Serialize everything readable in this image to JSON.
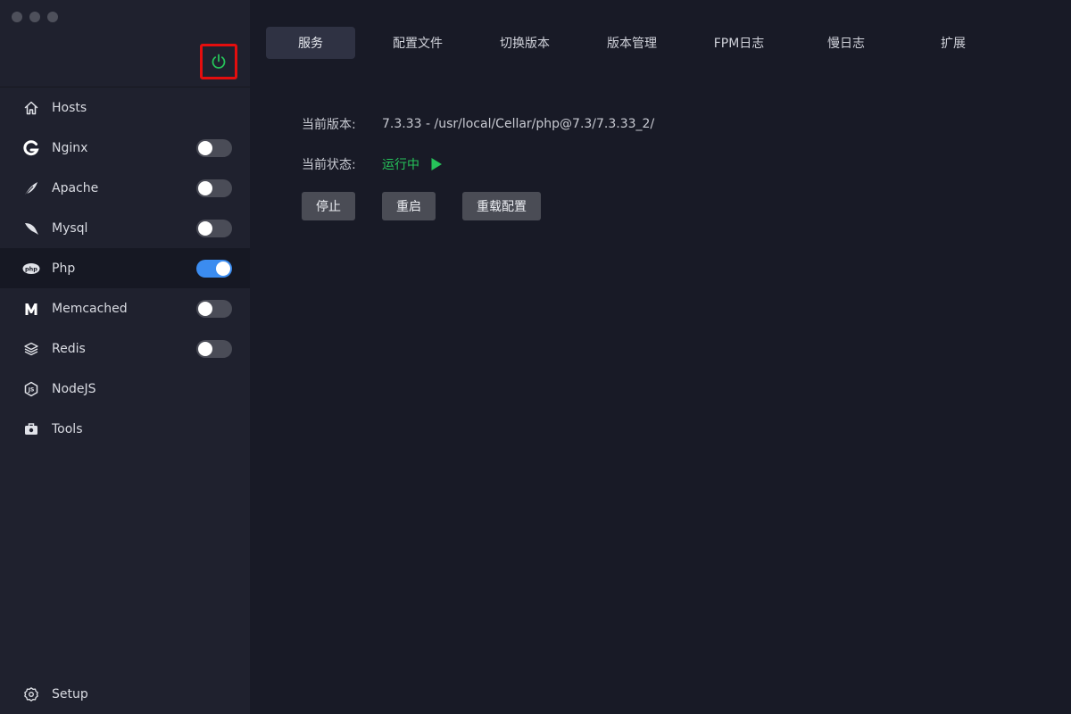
{
  "sidebar": {
    "items": [
      {
        "label": "Hosts",
        "icon": "home-icon"
      },
      {
        "label": "Nginx",
        "icon": "nginx-icon",
        "toggle": false
      },
      {
        "label": "Apache",
        "icon": "apache-feather-icon",
        "toggle": false
      },
      {
        "label": "Mysql",
        "icon": "mysql-dolphin-icon",
        "toggle": false
      },
      {
        "label": "Php",
        "icon": "php-icon",
        "toggle": true,
        "active": true
      },
      {
        "label": "Memcached",
        "icon": "memcached-icon",
        "toggle": false
      },
      {
        "label": "Redis",
        "icon": "redis-icon",
        "toggle": false
      },
      {
        "label": "NodeJS",
        "icon": "nodejs-icon"
      },
      {
        "label": "Tools",
        "icon": "toolbox-icon"
      }
    ],
    "setup": {
      "label": "Setup",
      "icon": "gear-icon"
    }
  },
  "tabs": [
    {
      "label": "服务",
      "active": true
    },
    {
      "label": "配置文件"
    },
    {
      "label": "切换版本"
    },
    {
      "label": "版本管理"
    },
    {
      "label": "FPM日志"
    },
    {
      "label": "慢日志"
    },
    {
      "label": "扩展"
    }
  ],
  "service": {
    "version_label": "当前版本:",
    "version_value": "7.3.33 - /usr/local/Cellar/php@7.3/7.3.33_2/",
    "status_label": "当前状态:",
    "status_value": "运行中"
  },
  "actions": {
    "stop": "停止",
    "restart": "重启",
    "reload": "重载配置"
  },
  "colors": {
    "accent": "#3b8cf0",
    "running": "#26c35a",
    "highlight": "#e40e0e"
  }
}
